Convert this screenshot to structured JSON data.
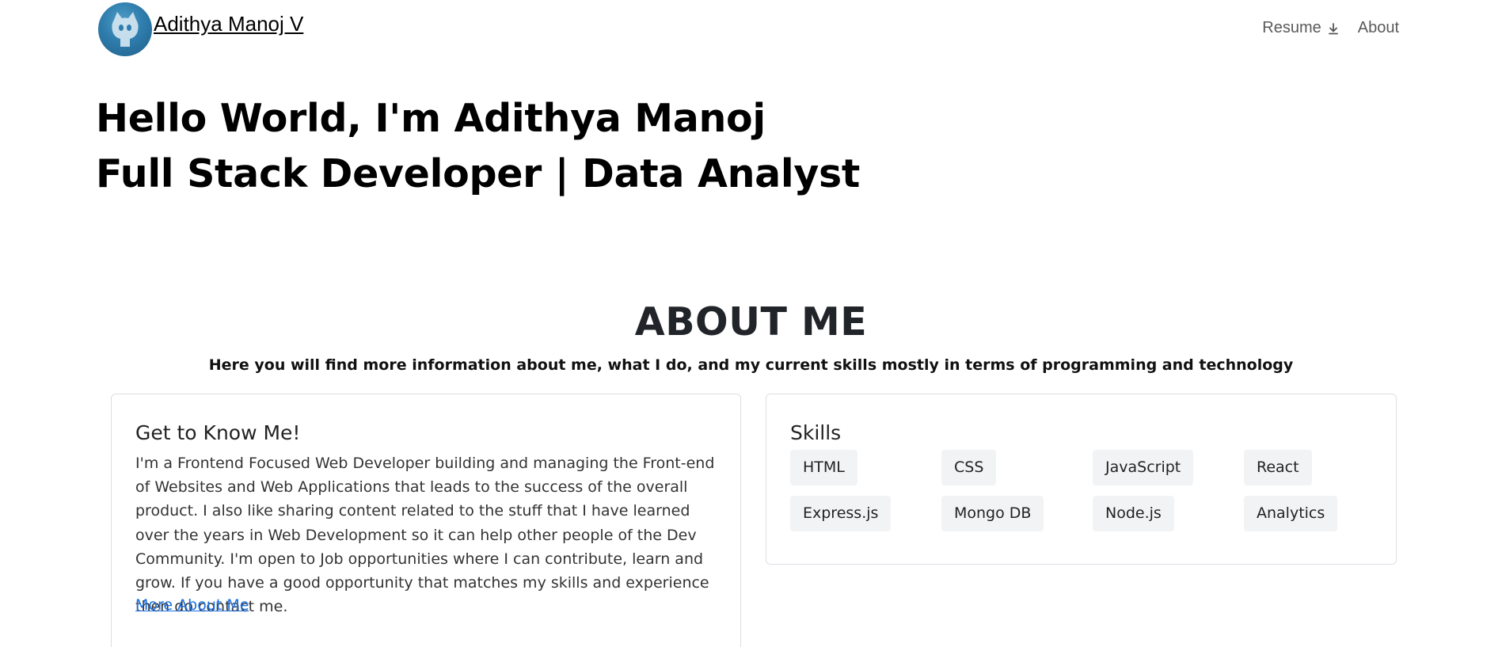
{
  "nav": {
    "brand_name": "Adithya Manoj V",
    "resume_label": "Resume",
    "about_label": "About"
  },
  "hero": {
    "line1": "Hello World, I'm Adithya Manoj",
    "line2": "Full Stack Developer | Data Analyst"
  },
  "about": {
    "title": "ABOUT ME",
    "subtitle": "Here you will find more information about me, what I do, and my current skills mostly in terms of programming and technology"
  },
  "know_me": {
    "title": "Get to Know Me!",
    "body": "I'm a Frontend Focused Web Developer building and managing the Front-end of Websites and Web Applications that leads to the success of the overall product. I also like sharing content related to the stuff that I have learned over the years in Web Development so it can help other people of the Dev Community. I'm open to Job opportunities where I can contribute, learn and grow. If you have a good opportunity that matches my skills and experience then do contact me.",
    "link_label": "More About Me"
  },
  "skills": {
    "title": "Skills",
    "items": [
      "HTML",
      "CSS",
      "JavaScript",
      "React",
      "Express.js",
      "Mongo DB",
      "Node.js",
      "Analytics"
    ]
  },
  "colors": {
    "link": "#1a6fe0",
    "chip_bg": "#f2f3f5",
    "card_border": "#dcdfe3"
  },
  "icons": {
    "resume": "download-icon",
    "avatar": "github-octocat-avatar"
  }
}
